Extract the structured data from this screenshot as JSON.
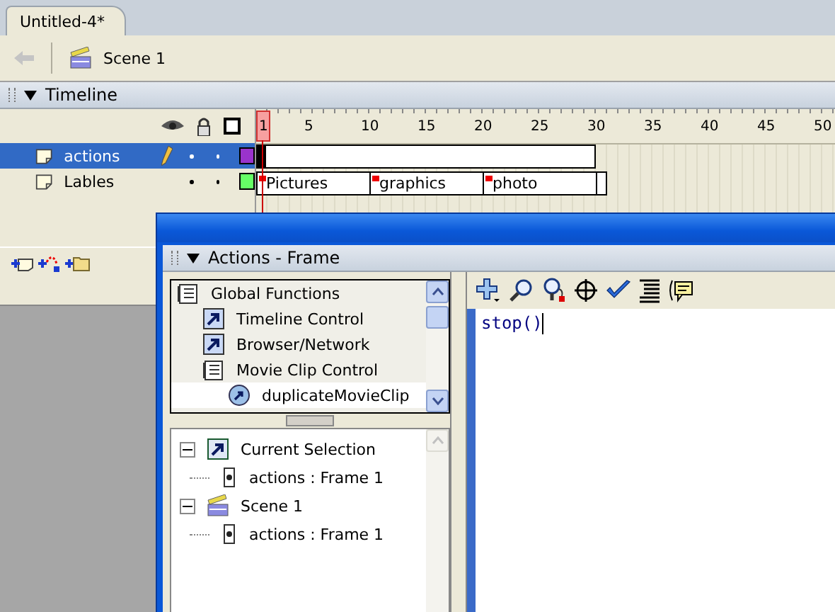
{
  "document_tabs": [
    {
      "title": "Untitled-4*",
      "selected": true
    }
  ],
  "scene_bar": {
    "scene": "Scene 1"
  },
  "timeline": {
    "title": "Timeline",
    "expanded": true,
    "ruler_labels": [
      "1",
      "5",
      "10",
      "15",
      "20",
      "25",
      "30",
      "35",
      "40",
      "45",
      "50"
    ],
    "layers": [
      {
        "name": "actions",
        "selected": true,
        "editing": true,
        "color": "#9933cc",
        "kind": "script"
      },
      {
        "name": "Lables",
        "selected": false,
        "editing": false,
        "color": "#66ff66",
        "kind": "labels",
        "frame_labels": [
          "Pictures",
          "graphics",
          "photo"
        ]
      }
    ]
  },
  "actions_panel": {
    "title": "Actions - Frame",
    "expanded": true,
    "toolbox": [
      {
        "label": "Global Functions",
        "kind": "book"
      },
      {
        "label": "Timeline Control",
        "kind": "category"
      },
      {
        "label": "Browser/Network",
        "kind": "category"
      },
      {
        "label": "Movie Clip Control",
        "kind": "book"
      },
      {
        "label": "duplicateMovieClip",
        "kind": "action"
      }
    ],
    "script_navigator": [
      {
        "label": "Current Selection",
        "kind": "selection",
        "expanded": true,
        "children": [
          {
            "label": "actions : Frame 1"
          }
        ]
      },
      {
        "label": "Scene 1",
        "kind": "scene",
        "expanded": true,
        "children": [
          {
            "label": "actions : Frame 1"
          }
        ]
      }
    ],
    "code": "stop()"
  }
}
